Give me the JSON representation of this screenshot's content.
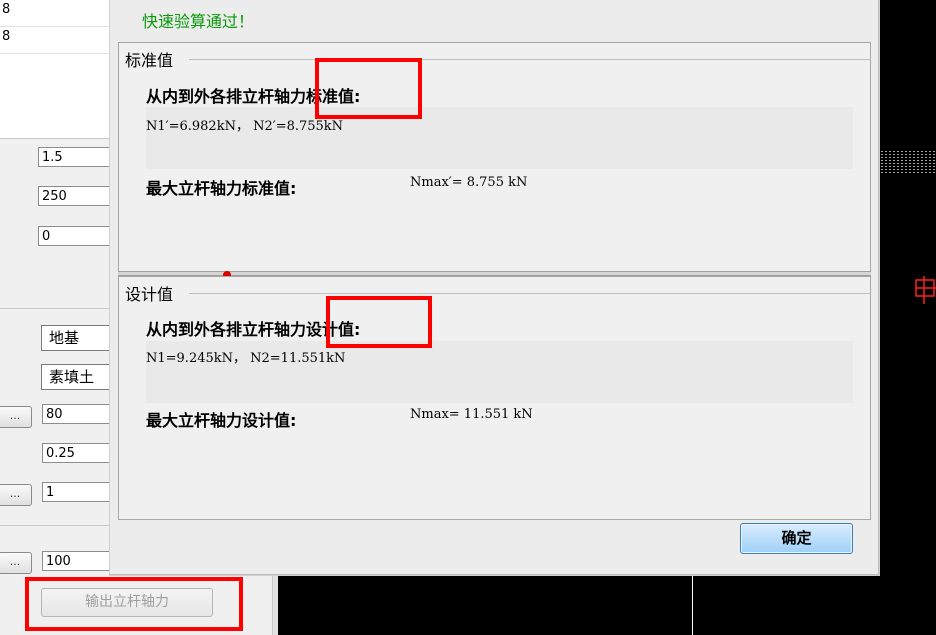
{
  "left_panel": {
    "top_rows": [
      "8",
      "8"
    ],
    "inputs_top": [
      "1.5",
      "250",
      "0"
    ],
    "combos": [
      "地基",
      "素填土"
    ],
    "dots_label": "...",
    "inputs_bottom": [
      "80",
      "0.25",
      "1",
      "100"
    ],
    "output_button": "输出立杆轴力"
  },
  "dialog": {
    "status": "快速验算通过！",
    "standard": {
      "title": "标准值",
      "heading": "从内到外各排立杆轴力标准值:",
      "values": "N1′=6.982kN，  N2′=8.755kN",
      "max_label": "最大立杆轴力标准值:",
      "max_value": "Nmax′= 8.755 kN"
    },
    "design": {
      "title": "设计值",
      "heading": "从内到外各排立杆轴力设计值:",
      "values": "N1=9.245kN，  N2=11.551kN",
      "max_label": "最大立杆轴力设计值:",
      "max_value": "Nmax= 11.551 kN"
    },
    "ok_button": "确定"
  },
  "colors": {
    "pass_text": "#0a9a0a",
    "highlight": "#ff0000",
    "ok_button": "#9fd0f7"
  }
}
